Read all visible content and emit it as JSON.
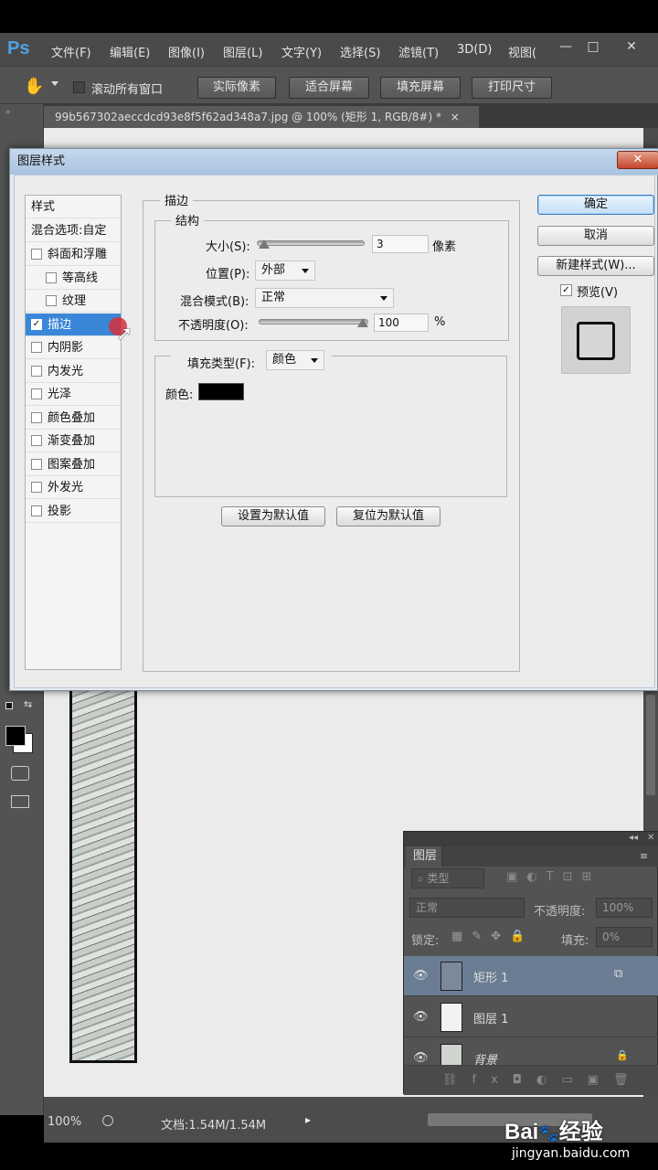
{
  "app": {
    "logo": "Ps",
    "menus": [
      "文件(F)",
      "编辑(E)",
      "图像(I)",
      "图层(L)",
      "文字(Y)",
      "选择(S)",
      "滤镜(T)",
      "3D(D)",
      "视图("
    ],
    "window_buttons": [
      "—",
      "□",
      "✕"
    ]
  },
  "options_bar": {
    "scroll_all": "滚动所有窗口",
    "buttons": [
      "实际像素",
      "适合屏幕",
      "填充屏幕",
      "打印尺寸"
    ]
  },
  "document_tab": {
    "title": "99b567302aeccdcd93e8f5f62ad348a7.jpg @ 100% (矩形 1, RGB/8#) *",
    "close": "×"
  },
  "dialog": {
    "title": "图层样式",
    "close": "✕",
    "styles_header": "样式",
    "blend_options": "混合选项:自定",
    "style_items": [
      {
        "label": "斜面和浮雕",
        "checked": false,
        "indent": false
      },
      {
        "label": "等高线",
        "checked": false,
        "indent": true
      },
      {
        "label": "纹理",
        "checked": false,
        "indent": true
      },
      {
        "label": "描边",
        "checked": true,
        "indent": false,
        "selected": true
      },
      {
        "label": "内阴影",
        "checked": false,
        "indent": false
      },
      {
        "label": "内发光",
        "checked": false,
        "indent": false
      },
      {
        "label": "光泽",
        "checked": false,
        "indent": false
      },
      {
        "label": "颜色叠加",
        "checked": false,
        "indent": false
      },
      {
        "label": "渐变叠加",
        "checked": false,
        "indent": false
      },
      {
        "label": "图案叠加",
        "checked": false,
        "indent": false
      },
      {
        "label": "外发光",
        "checked": false,
        "indent": false
      },
      {
        "label": "投影",
        "checked": false,
        "indent": false
      }
    ],
    "stroke": {
      "section_title": "描边",
      "structure_title": "结构",
      "size_label": "大小(S):",
      "size_value": "3",
      "size_unit": "像素",
      "size_level": 0.02,
      "position_label": "位置(P):",
      "position_value": "外部",
      "blend_mode_label": "混合模式(B):",
      "blend_mode_value": "正常",
      "opacity_label": "不透明度(O):",
      "opacity_value": "100",
      "opacity_unit": "%",
      "opacity_level": 1.0,
      "fill_type_label": "填充类型(F):",
      "fill_type_value": "颜色",
      "color_label": "颜色:",
      "color_value": "#000000"
    },
    "buttons": {
      "set_default": "设置为默认值",
      "reset_default": "复位为默认值",
      "ok": "确定",
      "cancel": "取消",
      "new_style": "新建样式(W)...",
      "preview": "预览(V)"
    }
  },
  "layers_panel": {
    "tab": "图层",
    "filter_kind": "类型",
    "blend_mode": "正常",
    "opacity_label": "不透明度:",
    "opacity_value": "100%",
    "lock_label": "锁定:",
    "fill_label": "填充:",
    "fill_value": "0%",
    "layers": [
      {
        "name": "矩形 1",
        "selected": true
      },
      {
        "name": "图层 1",
        "selected": false
      },
      {
        "name": "背景",
        "selected": false
      }
    ]
  },
  "status_bar": {
    "zoom": "100%",
    "doc_info": "文档:1.54M/1.54M"
  },
  "watermark": {
    "brand": "Bai",
    "brand2": "经验",
    "url": "jingyan.baidu.com"
  }
}
